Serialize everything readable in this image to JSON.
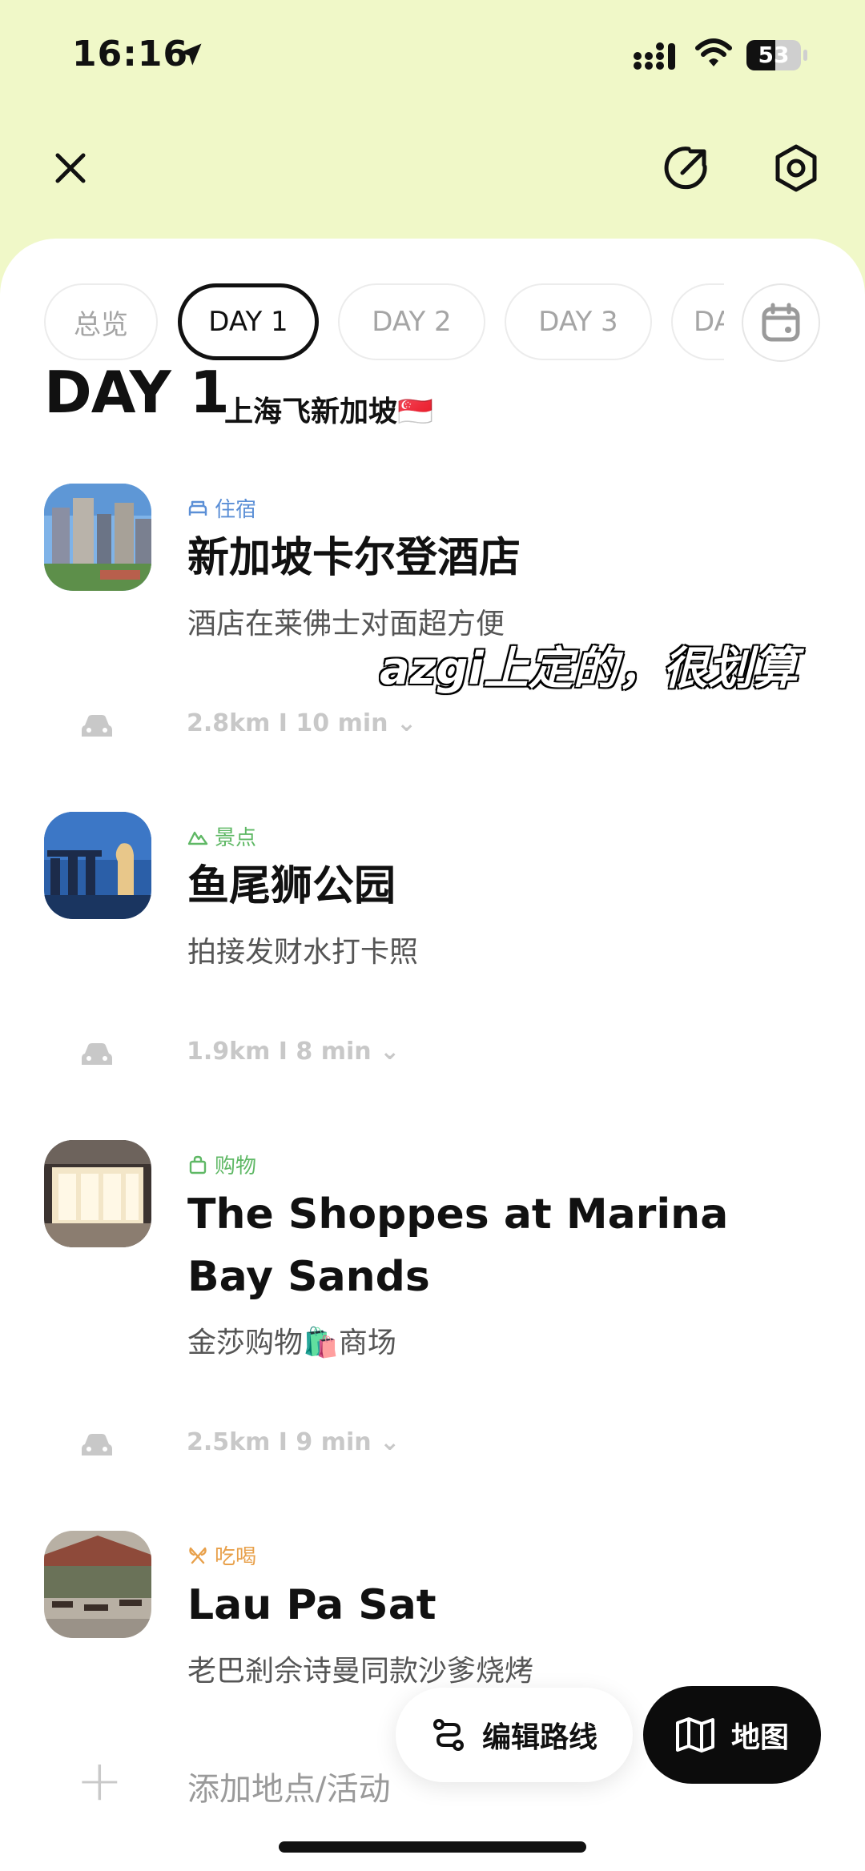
{
  "status": {
    "time": "16:16",
    "battery": "53",
    "battery_level": 0.53
  },
  "header": {
    "close_icon": "close-icon",
    "share_icon": "share-icon",
    "settings_icon": "settings-icon"
  },
  "tabs": [
    {
      "label": "总览",
      "active": false
    },
    {
      "label": "DAY 1",
      "active": true
    },
    {
      "label": "DAY 2",
      "active": false
    },
    {
      "label": "DAY 3",
      "active": false
    },
    {
      "label": "DA",
      "active": false
    }
  ],
  "day": {
    "title": "DAY 1",
    "subtitle": "上海飞新加坡🇸🇬"
  },
  "items": [
    {
      "category": "住宿",
      "category_color": "#5b8fd6",
      "name": "新加坡卡尔登酒店",
      "note": "酒店在莱佛士对面超方便"
    },
    {
      "category": "景点",
      "category_color": "#5fb865",
      "name": "鱼尾狮公园",
      "note": "拍接发财水打卡照"
    },
    {
      "category": "购物",
      "category_color": "#5fb865",
      "name": "The Shoppes at Marina Bay Sands",
      "note": "金莎购物🛍️商场"
    },
    {
      "category": "吃喝",
      "category_color": "#e8a04a",
      "name": "Lau Pa Sat",
      "note": "老巴剎佘诗曼同款沙爹烧烤"
    }
  ],
  "routes": [
    {
      "text": "2.8km  I  10 min ⌄"
    },
    {
      "text": "1.9km  I  8 min ⌄"
    },
    {
      "text": "2.5km  I  9 min ⌄"
    }
  ],
  "overlay_caption": "azgi上定的，很划算",
  "add_activity": "添加地点/活动",
  "buttons": {
    "edit_route": "编辑路线",
    "map": "地图"
  }
}
